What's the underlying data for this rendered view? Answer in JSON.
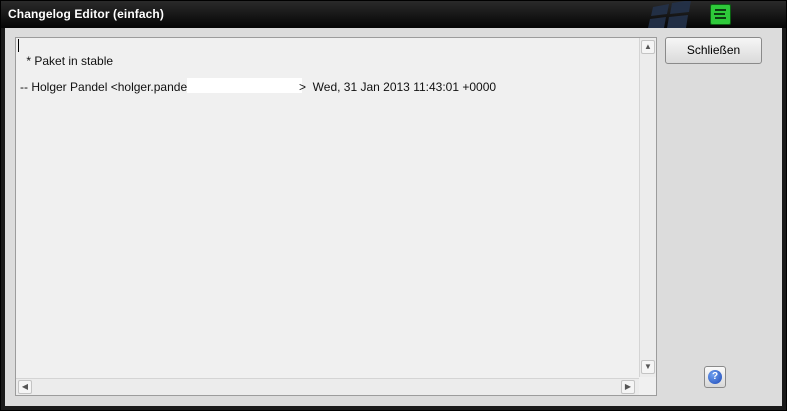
{
  "window": {
    "title": "Changelog Editor (einfach)"
  },
  "editor": {
    "lines": [
      " * Paket in stable",
      "-- Holger Pandel <holger.pandel@",
      ">  Wed, 31 Jan 2013 11:43:01 +0000"
    ]
  },
  "buttons": {
    "close_label": "Schließen",
    "help_glyph": "?"
  },
  "icons": {
    "app": "app-icon",
    "windows_logo": "windows-logo-icon",
    "help": "help-icon",
    "scroll_up": "scroll-up-icon",
    "scroll_down": "scroll-down-icon",
    "scroll_left": "scroll-left-icon",
    "scroll_right": "scroll-right-icon"
  },
  "colors": {
    "titlebar": "#050505",
    "app_icon": "#2ec93a",
    "help_icon": "#1d49b8"
  }
}
